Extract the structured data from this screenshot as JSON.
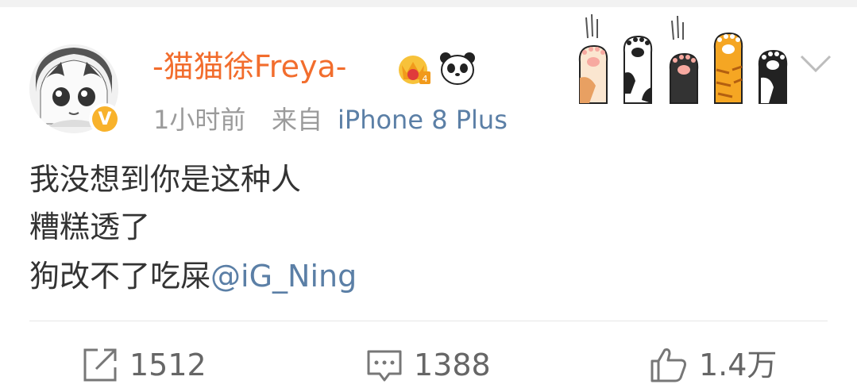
{
  "post": {
    "username": "-猫猫徐Freya-",
    "time": "1小时前",
    "source_prefix": "来自",
    "device": "iPhone 8 Plus",
    "text_lines": [
      "我没想到你是这种人",
      "糟糕透了",
      "狗改不了吃屎"
    ],
    "mention": "@iG_Ning"
  },
  "actions": {
    "repost_count": "1512",
    "comment_count": "1388",
    "like_count": "1.4万"
  },
  "icons": {
    "verified": "verified-v-icon",
    "crown": "crown-badge-icon",
    "panda": "panda-icon",
    "menu": "chevron-down-icon",
    "repost": "repost-icon",
    "comment": "comment-icon",
    "like": "thumbs-up-icon"
  },
  "colors": {
    "username": "#f26d2d",
    "link": "#5b7fa6",
    "meta": "#9b9b9b",
    "text": "#333333",
    "verified": "#f8b22b"
  }
}
